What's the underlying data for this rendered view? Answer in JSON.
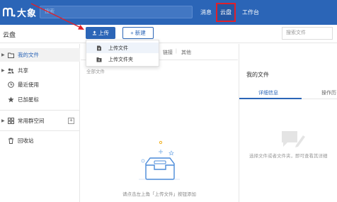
{
  "app": {
    "name": "大象"
  },
  "topbar": {
    "search_placeholder": "搜索",
    "nav": [
      {
        "label": "消息"
      },
      {
        "label": "云盘"
      },
      {
        "label": "工作台"
      }
    ]
  },
  "header": {
    "title": "云盘",
    "upload_label": "上传",
    "new_label": "+ 新建",
    "search_placeholder": "搜索文件"
  },
  "upload_menu": {
    "items": [
      {
        "label": "上传文件"
      },
      {
        "label": "上传文件夹"
      }
    ]
  },
  "sidebar": {
    "items": [
      {
        "label": "我的文件"
      },
      {
        "label": "共享"
      },
      {
        "label": "最近使用"
      },
      {
        "label": "已加星标"
      },
      {
        "label": "常用群空间"
      },
      {
        "label": "回收站"
      }
    ]
  },
  "main": {
    "tab_fragments": [
      "链接",
      "其他"
    ],
    "breadcrumb": "全部文件",
    "empty_hint": "请点击左上角「上传文件」按钮添加"
  },
  "right_panel": {
    "title": "我的文件",
    "tabs": [
      {
        "label": "详细信息"
      },
      {
        "label": "操作历"
      }
    ],
    "hint": "选择文件或者文件夹，即可查看其详细"
  },
  "colors": {
    "brand": "#2b65b7",
    "annotation": "#e0202a"
  }
}
